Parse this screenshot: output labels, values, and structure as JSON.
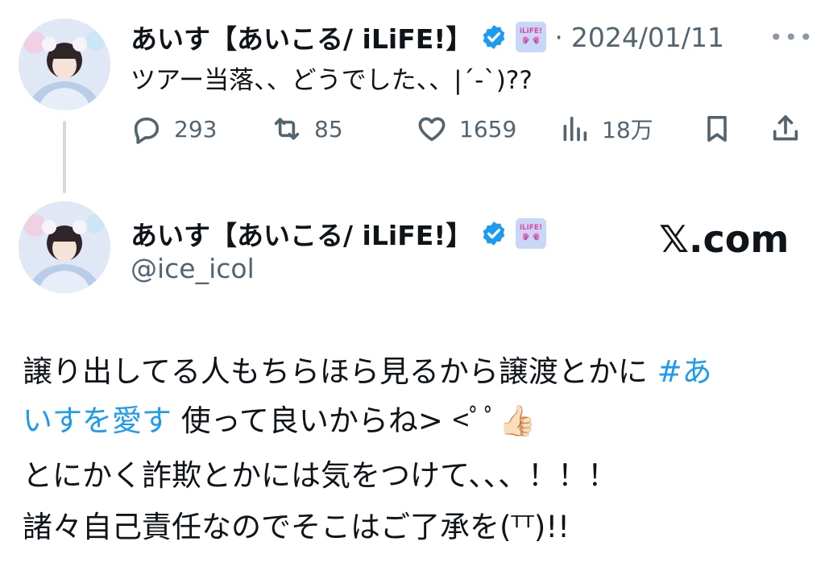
{
  "tweet1": {
    "display_name": "あいす【あいこる/ iLiFE!】",
    "badge_label": "iLiFE!",
    "separator": "·",
    "date": "2024/01/11",
    "more": "•••",
    "text": "ツアー当落、、どうでした、、|´-`)??",
    "actions": {
      "replies": "293",
      "retweets": "85",
      "likes": "1659",
      "views": "18万"
    },
    "icons": {
      "reply": "reply-icon",
      "retweet": "retweet-icon",
      "like": "heart-icon",
      "views": "views-icon",
      "bookmark": "bookmark-icon",
      "share": "share-icon"
    }
  },
  "tweet2": {
    "display_name": "あいす【あいこる/ iLiFE!】",
    "badge_label": "iLiFE!",
    "handle": "@ice_icol",
    "site_label": "𝕏.com",
    "body": {
      "line1_text": "譲り出してる人もちらほら見るから譲渡とかに ",
      "line1_hashtag": "#あ",
      "line2_hashtag": "いすを愛す",
      "line2_text": " 使って良いからね> <ﾟﾟ",
      "line2_emoji": "👍🏻",
      "line3": "とにかく詐欺とかには気をつけて、、、！！！",
      "line4": "諸々自己責任なのでそこはご了承を(ᵀᵀ)!!"
    }
  },
  "colors": {
    "verified": "#1d9bf0",
    "link": "#1d9bf0",
    "muted": "#536471",
    "text": "#0f1419"
  }
}
